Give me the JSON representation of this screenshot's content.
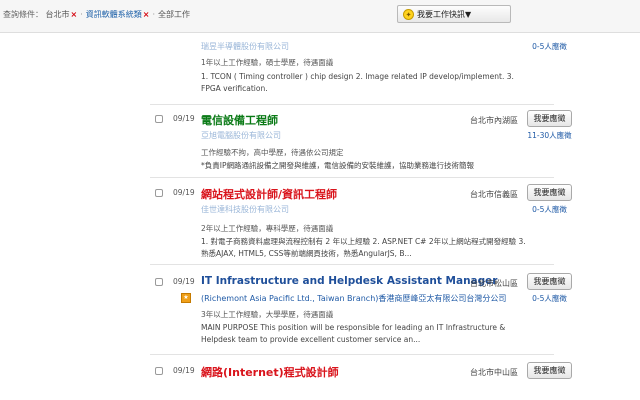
{
  "filters": {
    "label": "查詢條件：",
    "location": "台北市",
    "category": "資訊軟體系統類",
    "worktype": "全部工作",
    "remove_glyph": "×",
    "separator": "‧"
  },
  "subscribe_button": {
    "label": "我要工作快訊▼",
    "icon": "lightbulb-icon"
  },
  "apply_label": "我要應徵",
  "colors": {
    "green_title": "#0a7a16",
    "red_title": "#d9141c",
    "blue_title": "#1f4f9a",
    "link": "#1f5aa6"
  },
  "jobs": [
    {
      "company": "瑞昱半導體股份有限公司",
      "applicants": "0-5人應徵",
      "requirements": "1年以上工作經驗，碩士學歷，待遇面議",
      "description": "1. TCON ( Timing controller ) chip design 2. Image related IP develop/implement. 3. FPGA verification."
    },
    {
      "date": "09/19",
      "title": "電信設備工程師",
      "company": "亞旭電腦股份有限公司",
      "location": "台北市內湖區",
      "applicants": "11-30人應徵",
      "requirements": "工作經驗不拘，高中學歷，待遇依公司規定",
      "description": "*負責IP網路通訊設備之開發與維護，電信設備的安裝維護，協助業務進行技術簡報"
    },
    {
      "date": "09/19",
      "title": "網站程式設計師/資訊工程師",
      "company": "佳世達科技股份有限公司",
      "location": "台北市信義區",
      "applicants": "0-5人應徵",
      "requirements": "2年以上工作經驗，專科學歷，待遇面議",
      "description": "1. 對電子商務資料處理與流程控制有 2 年以上經驗 2. ASP.NET C# 2年以上網站程式開發經驗 3. 熟悉AJAX, HTML5, CSS等前端網頁技術，熟悉AngularJS, B..."
    },
    {
      "date": "09/19",
      "title": "IT Infrastructure and Helpdesk Assistant Manager",
      "company": "(Richemont Asia Pacific Ltd., Taiwan Branch)香港商歷峰亞太有限公司台灣分公司",
      "location": "台北市松山區",
      "applicants": "0-5人應徵",
      "requirements": "3年以上工作經驗，大學學歷，待遇面議",
      "description": "MAIN PURPOSE This position will be responsible for leading an IT Infrastructure & Helpdesk team to provide excellent customer service an..."
    },
    {
      "date": "09/19",
      "title": "網路(Internet)程式設計師",
      "location": "台北市中山區"
    }
  ]
}
